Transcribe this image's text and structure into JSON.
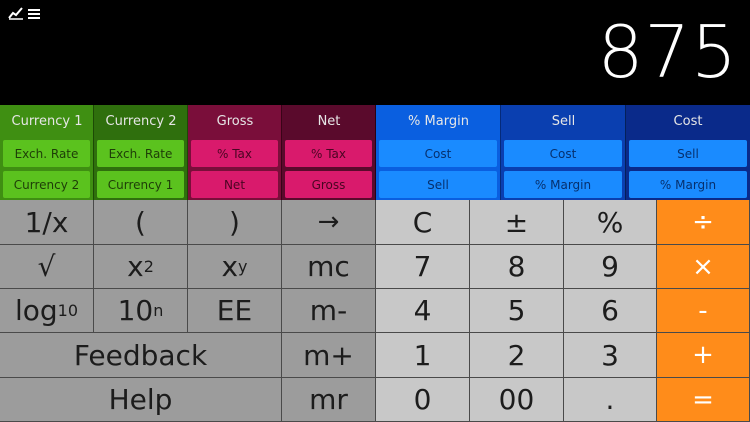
{
  "toolbar": {
    "chart_icon": "chart-line-icon",
    "menu_icon": "hamburger-menu-icon"
  },
  "display": {
    "value": "875"
  },
  "functions": {
    "currency1": {
      "header": "Currency 1",
      "b1": "Exch. Rate",
      "b2": "Currency 2"
    },
    "currency2": {
      "header": "Currency 2",
      "b1": "Exch. Rate",
      "b2": "Currency 1"
    },
    "gross": {
      "header": "Gross",
      "b1": "% Tax",
      "b2": "Net"
    },
    "net": {
      "header": "Net",
      "b1": "% Tax",
      "b2": "Gross"
    },
    "margin": {
      "header": "% Margin",
      "b1": "Cost",
      "b2": "Sell"
    },
    "sell": {
      "header": "Sell",
      "b1": "Cost",
      "b2": "% Margin"
    },
    "cost": {
      "header": "Cost",
      "b1": "Sell",
      "b2": "% Margin"
    }
  },
  "keys": {
    "recip": "1/x",
    "lparen": "(",
    "rparen": ")",
    "arrow": "→",
    "clear": "C",
    "plusminus": "±",
    "percent": "%",
    "divide": "÷",
    "sqrt": "√",
    "x2_base": "x",
    "x2_exp": "2",
    "xy_base": "x",
    "xy_exp": "y",
    "mc": "mc",
    "n7": "7",
    "n8": "8",
    "n9": "9",
    "multiply": "×",
    "log_base": "log",
    "log_sub": "10",
    "pow10_base": "10",
    "pow10_exp": "n",
    "ee": "EE",
    "mminus": "m-",
    "n4": "4",
    "n5": "5",
    "n6": "6",
    "minus": "-",
    "feedback": "Feedback",
    "mplus": "m+",
    "n1": "1",
    "n2": "2",
    "n3": "3",
    "plus": "+",
    "help": "Help",
    "mr": "mr",
    "n0": "0",
    "n00": "00",
    "dot": ".",
    "equals": "="
  },
  "colors": {
    "currency1_head": "#3f8f12",
    "currency1_btn": "#5bc21e",
    "currency2_head": "#2f6f0d",
    "currency2_btn": "#5bc21e",
    "gross_head": "#7a0e3a",
    "gross_btn": "#d91a6c",
    "net_head": "#5a0a2c",
    "net_btn": "#d91a6c",
    "margin_head": "#0a5fe0",
    "margin_btn": "#1a8bff",
    "sell_head": "#0a3fb0",
    "sell_btn": "#1a8bff",
    "cost_head": "#0a2a8a",
    "cost_btn": "#1a8bff",
    "orange": "#ff8c1a"
  }
}
